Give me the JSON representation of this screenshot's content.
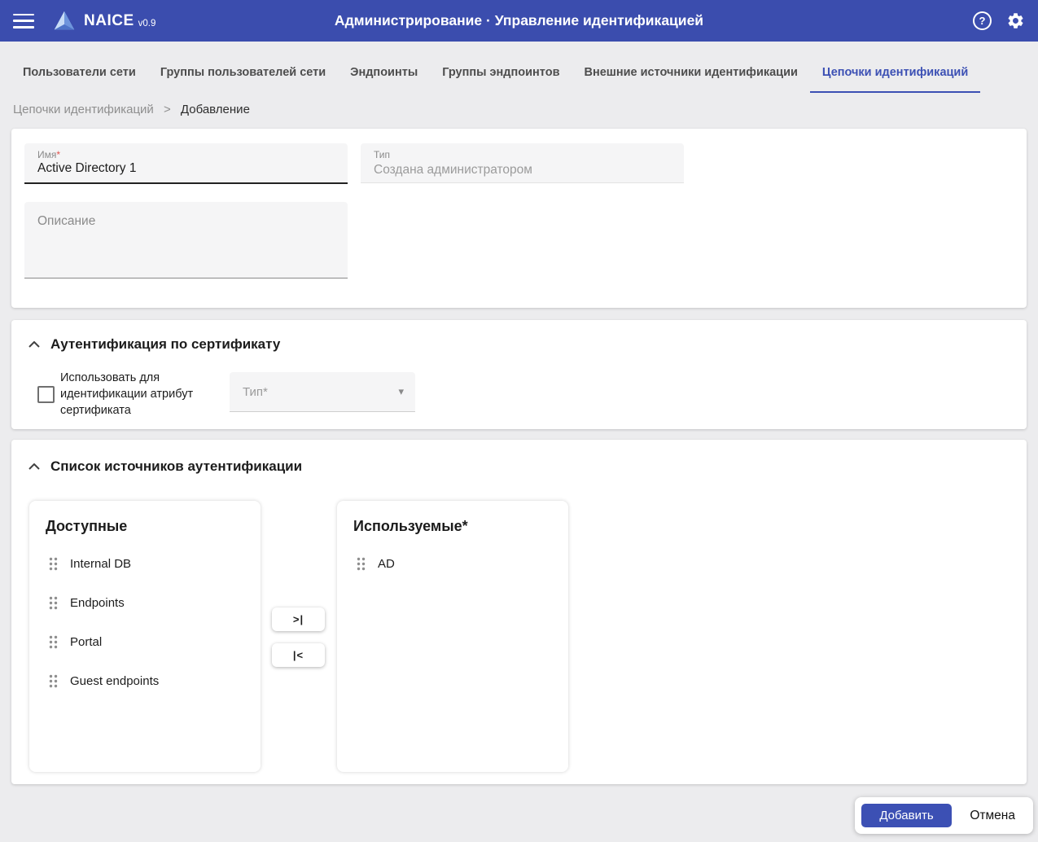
{
  "colors": {
    "header_bg": "#3B4DAE",
    "accent": "#3C50B4",
    "page_bg": "#ECECEE",
    "required_red": "#E0524D"
  },
  "header": {
    "brand": "NAICE",
    "version": "v0.9",
    "title": "Администрирование · Управление идентификацией"
  },
  "icons": {
    "help": "?",
    "dropdown_arrow": "▾",
    "breadcrumb_separator": ">"
  },
  "tabs": [
    {
      "label": "Пользователи сети"
    },
    {
      "label": "Группы пользователей сети"
    },
    {
      "label": "Эндпоинты"
    },
    {
      "label": "Группы эндпоинтов"
    },
    {
      "label": "Внешние источники идентификации"
    },
    {
      "label": "Цепочки идентификаций",
      "active": true
    }
  ],
  "breadcrumb": {
    "parent": "Цепочки идентификаций",
    "current": "Добавление"
  },
  "form": {
    "name": {
      "label": "Имя",
      "required_mark": "*",
      "value": "Active Directory 1"
    },
    "type": {
      "label": "Тип",
      "value": "Создана администратором"
    },
    "description": {
      "placeholder": "Описание",
      "value": ""
    }
  },
  "cert_section": {
    "title": "Аутентификация по сертификату",
    "checkbox_label": "Использовать для идентификации атрибут сертификата",
    "checkbox_checked": false,
    "type_select": {
      "label": "Тип*"
    }
  },
  "sources_section": {
    "title": "Список источников аутентификации",
    "available": {
      "title": "Доступные",
      "items": [
        "Internal DB",
        "Endpoints",
        "Portal",
        "Guest endpoints"
      ]
    },
    "used": {
      "title": "Используемые*",
      "items": [
        "AD"
      ]
    },
    "move_all_right": ">|",
    "move_all_left": "|<"
  },
  "footer": {
    "submit": "Добавить",
    "cancel": "Отмена"
  }
}
